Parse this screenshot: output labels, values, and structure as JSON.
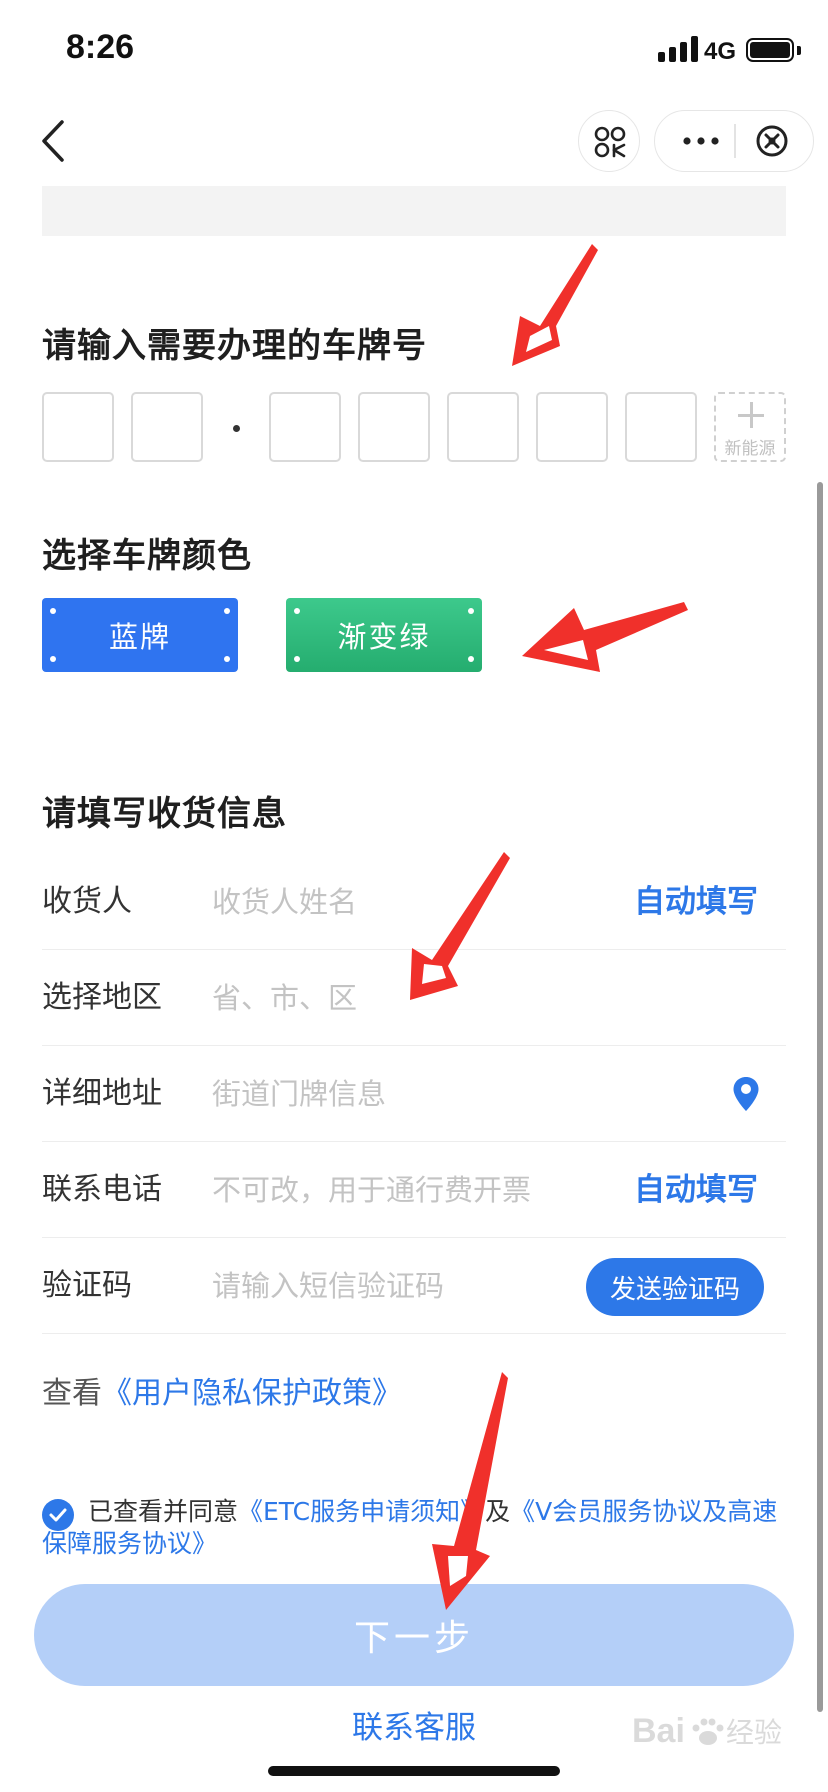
{
  "status_bar": {
    "time": "8:26",
    "network": "4G"
  },
  "icons": {
    "back": "chevron-left-icon",
    "scan": "scan-icon",
    "more": "more-dots-icon",
    "close": "close-circle-icon",
    "location": "location-pin-icon",
    "check": "check-circle-icon"
  },
  "plate": {
    "title": "请输入需要办理的车牌号",
    "new_energy_label": "新能源"
  },
  "plate_color": {
    "title": "选择车牌颜色",
    "options": [
      "蓝牌",
      "渐变绿"
    ]
  },
  "shipping": {
    "title": "请填写收货信息",
    "rows": [
      {
        "label": "收货人",
        "placeholder": "收货人姓名",
        "action": "自动填写"
      },
      {
        "label": "选择地区",
        "placeholder": "省、市、区"
      },
      {
        "label": "详细地址",
        "placeholder": "街道门牌信息"
      },
      {
        "label": "联系电话",
        "placeholder": "不可改，用于通行费开票",
        "action": "自动填写"
      },
      {
        "label": "验证码",
        "placeholder": "请输入短信验证码",
        "action": "发送验证码"
      }
    ]
  },
  "privacy": {
    "prefix": "查看",
    "link": "《用户隐私保护政策》"
  },
  "agreement": {
    "prefix": "已查看并同意",
    "link1": "《ETC服务申请须知》",
    "middle": "及",
    "link2": "《V会员服务协议及高速保障服务协议》"
  },
  "buttons": {
    "next": "下一步",
    "contact": "联系客服"
  },
  "watermark": "Baidu经验",
  "colors": {
    "accent": "#2d78e8",
    "blue_plate": "#2f74f0",
    "green_plate": "#25ad6f",
    "next_disabled": "#b4cff8",
    "annotation_arrow": "#f0302b"
  }
}
